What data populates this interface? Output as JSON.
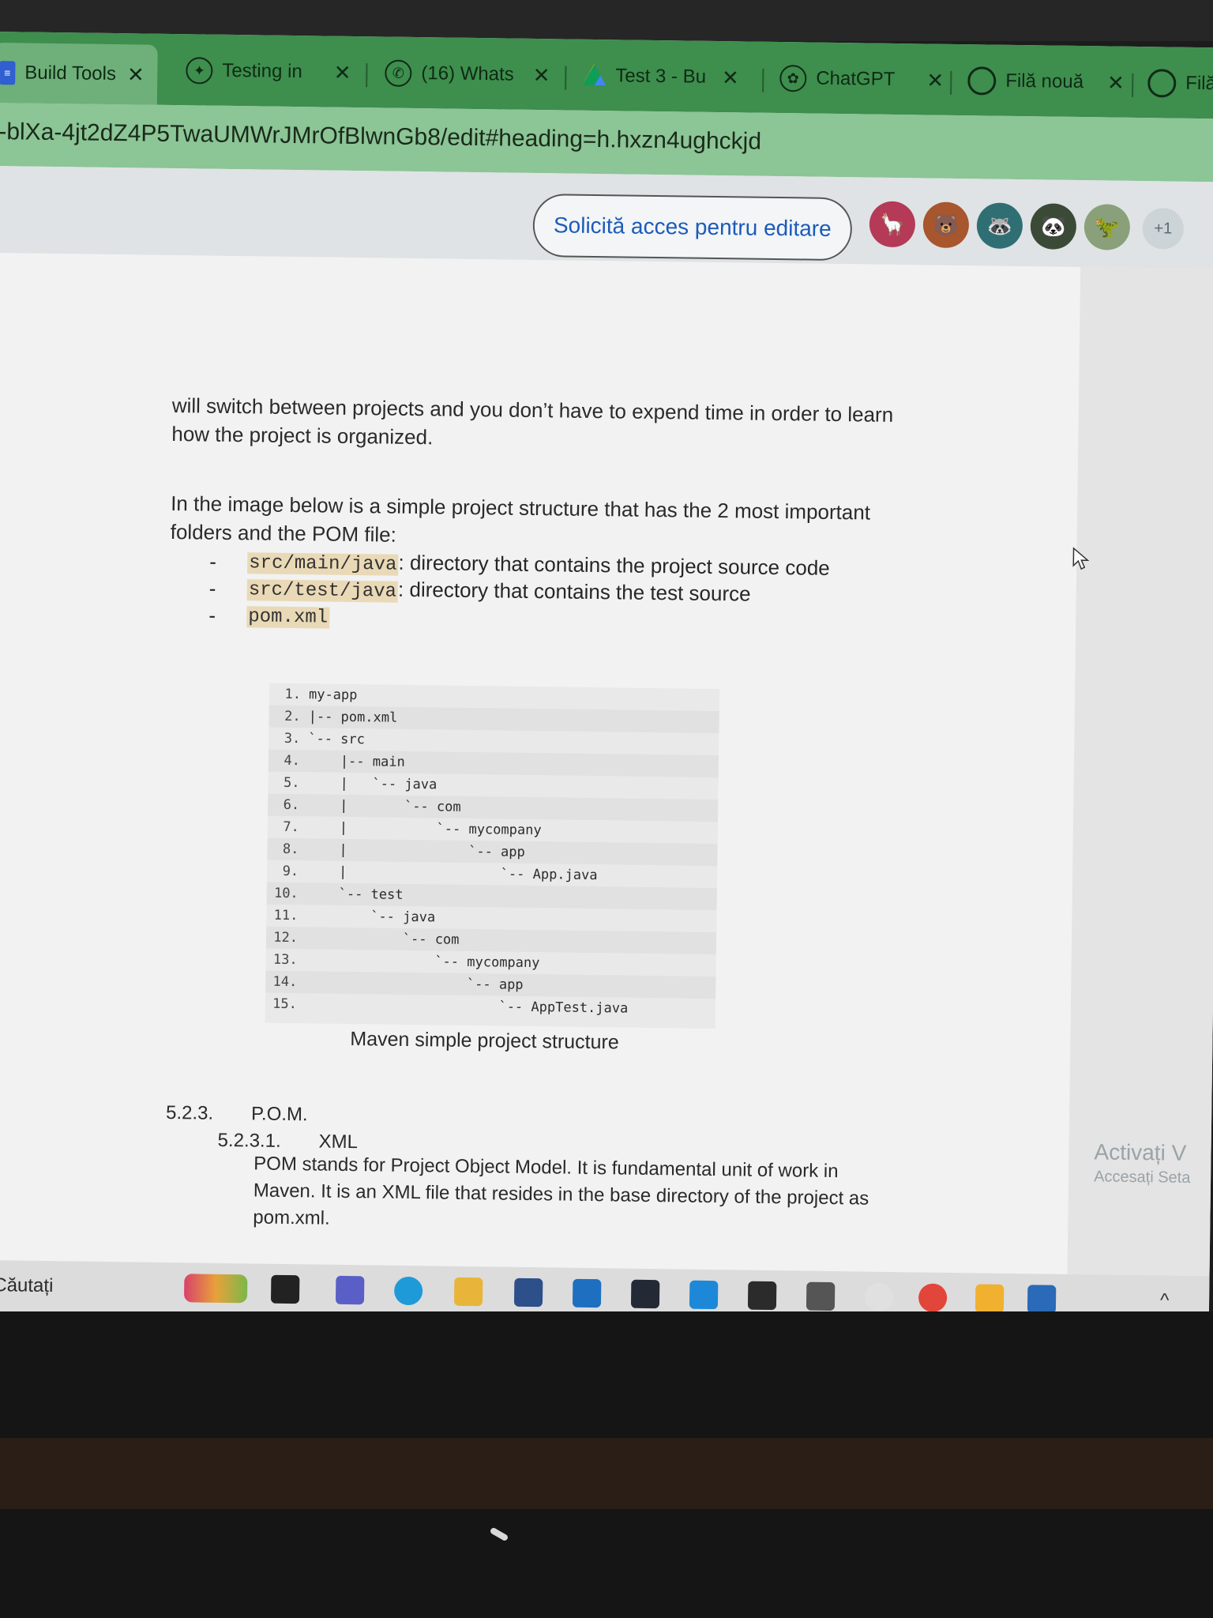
{
  "tabs": [
    {
      "label": "Build Tools",
      "icon": "docs-icon",
      "close": "✕"
    },
    {
      "label": "Testing in",
      "icon": "gemini-icon",
      "close": "✕"
    },
    {
      "label": "(16) Whats",
      "icon": "whatsapp-icon",
      "close": "✕"
    },
    {
      "label": "Test 3 - Bu",
      "icon": "drive-icon",
      "close": "✕"
    },
    {
      "label": "ChatGPT",
      "icon": "chatgpt-icon",
      "close": "✕"
    },
    {
      "label": "Filă nouă",
      "icon": "chrome-icon",
      "close": "✕"
    },
    {
      "label": "Filă",
      "icon": "chrome-icon",
      "close": ""
    }
  ],
  "address": {
    "url": "-blXa-4jt2dZ4P5TwaUMWrJMrOfBlwnGb8/edit#heading=h.hxzn4ughckjd"
  },
  "docbar": {
    "request_edit": "Solicită acces pentru editare",
    "more_users": "+1"
  },
  "doc": {
    "para1_line1": "will switch between projects and you don’t have to expend time in order to learn",
    "para1_line2": "how the project is organized.",
    "para2_line1": "In the image below is a simple project structure that has the 2 most important",
    "para2_line2": "folders and the POM file:",
    "bullets": [
      {
        "dash": "-",
        "code": "src/main/java",
        "text": ": directory that contains the project source code"
      },
      {
        "dash": "-",
        "code": "src/test/java",
        "text": ": directory that contains the test source"
      },
      {
        "dash": "-",
        "code": "pom.xml",
        "text": ""
      }
    ],
    "code_lines": [
      {
        "num": "1.",
        "text": "my-app"
      },
      {
        "num": "2.",
        "text": "|-- pom.xml"
      },
      {
        "num": "3.",
        "text": "`-- src"
      },
      {
        "num": "4.",
        "text": "    |-- main"
      },
      {
        "num": "5.",
        "text": "    |   `-- java"
      },
      {
        "num": "6.",
        "text": "    |       `-- com"
      },
      {
        "num": "7.",
        "text": "    |           `-- mycompany"
      },
      {
        "num": "8.",
        "text": "    |               `-- app"
      },
      {
        "num": "9.",
        "text": "    |                   `-- App.java"
      },
      {
        "num": "10.",
        "text": "    `-- test"
      },
      {
        "num": "11.",
        "text": "        `-- java"
      },
      {
        "num": "12.",
        "text": "            `-- com"
      },
      {
        "num": "13.",
        "text": "                `-- mycompany"
      },
      {
        "num": "14.",
        "text": "                    `-- app"
      },
      {
        "num": "15.",
        "text": "                        `-- AppTest.java"
      }
    ],
    "caption": "Maven simple project structure",
    "section_num": "5.2.3.",
    "section_title": "P.O.M.",
    "subsection_num": "5.2.3.1.",
    "subsection_title": "XML",
    "body_line1": "POM stands for Project Object Model. It is fundamental unit of work in",
    "body_line2": "Maven. It is an XML file that resides in the base directory of the project as",
    "body_line3": "pom.xml."
  },
  "watermark": {
    "line1": "Activați V",
    "line2": "Accesați Seta"
  },
  "taskbar": {
    "search": "Căutați",
    "chevron": "^"
  },
  "colors": {
    "tab_bar": "#3e8e4e",
    "address_bar": "#8cc596",
    "link_blue": "#1c5bb9",
    "code_highlight": "#e9d9b6"
  }
}
